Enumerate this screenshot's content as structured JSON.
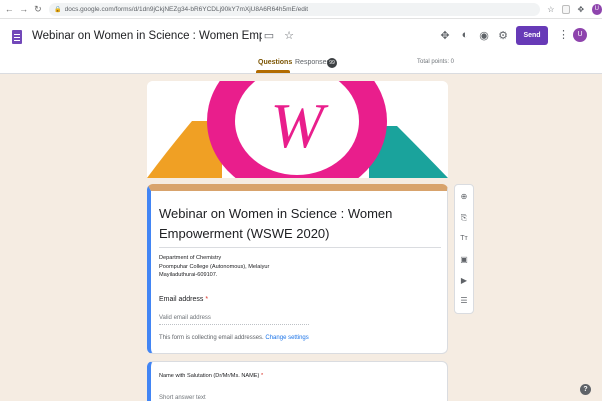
{
  "browser": {
    "url": "docs.google.com/forms/d/1dn9jCkjNEZg34-bR6YCDLj90kY7mXjU8A6R64h5mE/edit",
    "back_icon": "←",
    "forward_icon": "→",
    "reload_icon": "↻",
    "lock_icon": "🔒",
    "star_icon": "☆",
    "puzzle_icon": "✥",
    "profile_initial": "U"
  },
  "header": {
    "form_title": "Webinar on Women in Science : Women Empowerment (WS",
    "folder_icon": "▭",
    "star_icon": "☆",
    "addon_icon": "✥",
    "palette_icon": "◐",
    "preview_icon": "◉",
    "settings_icon": "⚙",
    "send_label": "Send",
    "more_icon": "⋮",
    "avatar_initial": "U",
    "accent": "#673ab7"
  },
  "tabs": {
    "questions": "Questions",
    "responses": "Responses",
    "responses_count": "99",
    "total_points": "Total points: 0"
  },
  "banner": {
    "letter": "W",
    "colors": [
      "#e91e8c",
      "#f0a024",
      "#1aa39c"
    ]
  },
  "form": {
    "title": "Webinar on Women in Science : Women Empowerment (WSWE 2020)",
    "description": "Department of Chemistry\nPoompuhar College (Autonomous), Melaiyur\nMayiladuthurai-609107.",
    "email_label": "Email address",
    "required_mark": "*",
    "email_placeholder": "Valid email address",
    "collect_note": "This form is collecting email addresses.",
    "change_settings": "Change settings"
  },
  "question2": {
    "label": "Name with Salutation (Dr/Mr/Ms. NAME)",
    "required_mark": "*",
    "placeholder": "Short answer text"
  },
  "toolbar": {
    "add_icon": "⊕",
    "import_icon": "⎘",
    "title_icon": "Tт",
    "image_icon": "▣",
    "video_icon": "▶",
    "section_icon": "☰"
  },
  "help_icon": "?"
}
